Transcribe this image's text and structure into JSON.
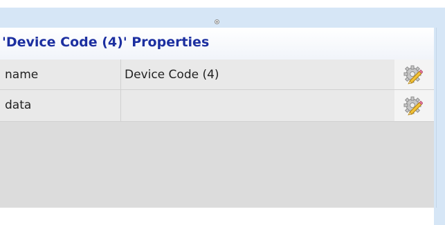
{
  "panel": {
    "title": "'Device Code (4)' Properties",
    "rows": [
      {
        "key": "name",
        "value": "Device Code (4)",
        "action_icon": "gear-edit-icon"
      },
      {
        "key": "data",
        "value": "",
        "action_icon": "gear-edit-icon"
      }
    ]
  },
  "colors": {
    "title_text": "#1c2fa0",
    "splitter_bar": "#d6e6f6",
    "panel_bg": "#dcdcdc",
    "row_bg": "#e9e9e9"
  }
}
